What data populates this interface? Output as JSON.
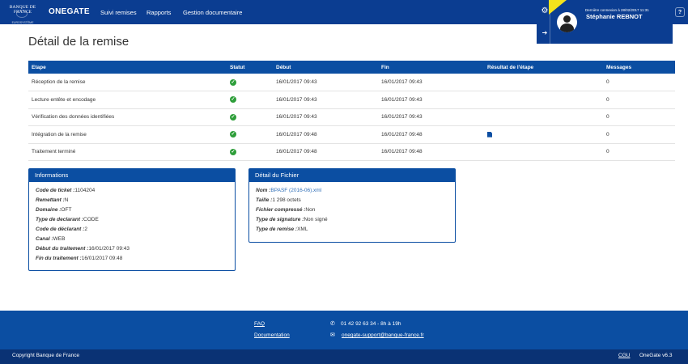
{
  "header": {
    "logo_line1": "BANQUE DE FRANCE",
    "logo_line2": "EUROSYSTÈME",
    "brand": "ONEGATE",
    "nav": [
      "Suivi remises",
      "Rapports",
      "Gestion documentaire"
    ]
  },
  "user": {
    "last_connection": "Dernière connexion à 28/02/2017 11:31",
    "name": "Stéphanie REBNOT",
    "help_label": "?"
  },
  "page": {
    "title": "Détail de la remise"
  },
  "steps_table": {
    "headers": [
      "Etape",
      "Statut",
      "Début",
      "Fin",
      "Résultat de l'étape",
      "Messages"
    ],
    "rows": [
      {
        "etape": "Réception de la remise",
        "debut": "16/01/2017 09:43",
        "fin": "16/01/2017 09:43",
        "result_doc": false,
        "messages": "0"
      },
      {
        "etape": "Lecture entête et encodage",
        "debut": "16/01/2017 09:43",
        "fin": "16/01/2017 09:43",
        "result_doc": false,
        "messages": "0"
      },
      {
        "etape": "Vérification des données identifiées",
        "debut": "16/01/2017 09:43",
        "fin": "16/01/2017 09:43",
        "result_doc": false,
        "messages": "0"
      },
      {
        "etape": "Intégration de la remise",
        "debut": "16/01/2017 09:48",
        "fin": "16/01/2017 09:48",
        "result_doc": true,
        "messages": "0"
      },
      {
        "etape": "Traitement terminé",
        "debut": "16/01/2017 09:48",
        "fin": "16/01/2017 09:48",
        "result_doc": false,
        "messages": "0"
      }
    ]
  },
  "informations": {
    "title": "Informations",
    "fields": [
      {
        "label": "Code de ticket :",
        "value": "1104204"
      },
      {
        "label": "Remettant :",
        "value": "N"
      },
      {
        "label": "Domaine :",
        "value": "OFT"
      },
      {
        "label": "Type de declarant :",
        "value": "CODE"
      },
      {
        "label": "Code de déclarant :",
        "value": "2"
      },
      {
        "label": "Canal :",
        "value": "WEB"
      },
      {
        "label": "Début du traitement :",
        "value": "16/01/2017 09:43"
      },
      {
        "label": "Fin du traitement :",
        "value": "16/01/2017 09:48"
      }
    ]
  },
  "fichier": {
    "title": "Détail du Fichier",
    "fields": [
      {
        "label": "Nom :",
        "value": "BPASF (2016-06).xml"
      },
      {
        "label": "Taille :",
        "value": "1 298 octets"
      },
      {
        "label": "Fichier compressé :",
        "value": "Non"
      },
      {
        "label": "Type de signature :",
        "value": "Non signé"
      },
      {
        "label": "Type de remise :",
        "value": "XML"
      }
    ]
  },
  "footer": {
    "faq": "FAQ",
    "documentation": "Documentation",
    "phone": "01 42 92 63 34  -  8h à 19h",
    "email": "onegate-support@banque-france.fr",
    "copyright": "Copyright Banque de France",
    "cgu": "CGU",
    "version": "OneGate v6.3"
  }
}
